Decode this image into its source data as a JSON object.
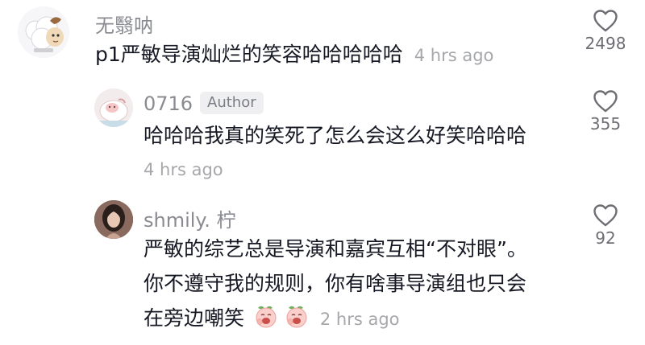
{
  "comments": [
    {
      "username": "无翳呐",
      "text_lines": [
        "p1严敏导演灿烂的笑容哈哈哈哈哈"
      ],
      "time": "4 hrs ago",
      "likes": "2498",
      "avatar_icon": "cartoon-sheep-avatar"
    },
    {
      "username": "0716",
      "badge": "Author",
      "text_lines": [
        "哈哈哈我真的笑死了怎么会这么好笑哈哈哈"
      ],
      "time": "4 hrs ago",
      "likes": "355",
      "avatar_icon": "pink-character-avatar"
    },
    {
      "username": "shmily. 柠",
      "text_lines": [
        "严敏的综艺总是导演和嘉宾互相“不对眼”。",
        "你不遵守我的规则，你有啥事导演组也只会",
        "在旁边嘲笑"
      ],
      "emoji": [
        "laughing-peach-emoji",
        "laughing-peach-emoji"
      ],
      "time": "2 hrs ago",
      "likes": "92",
      "avatar_icon": "girl-photo-avatar"
    }
  ],
  "colors": {
    "text": "#161823",
    "meta": "#8a8b91",
    "time": "#a6a7ab",
    "heart": "#6d6e74"
  }
}
